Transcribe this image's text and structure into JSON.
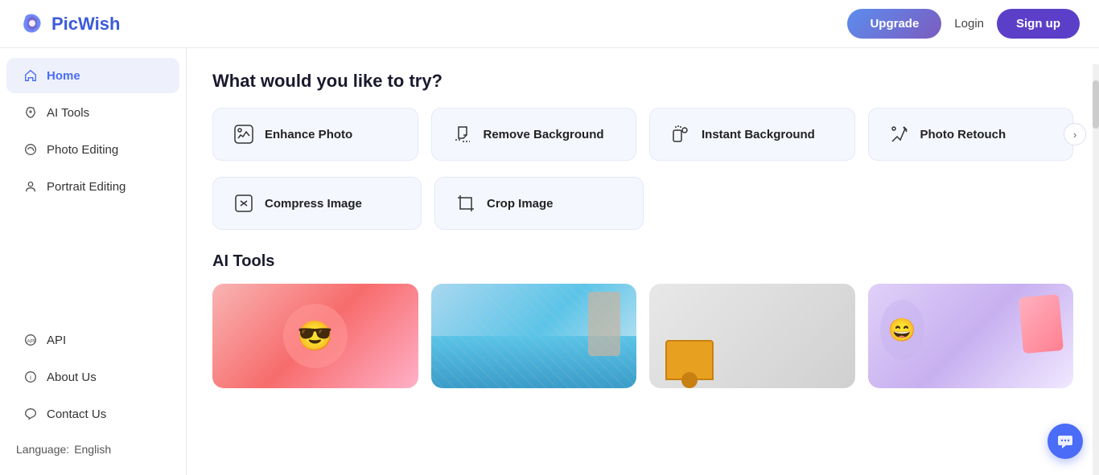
{
  "header": {
    "logo_text": "PicWish",
    "upgrade_label": "Upgrade",
    "login_label": "Login",
    "signup_label": "Sign up"
  },
  "sidebar": {
    "items": [
      {
        "id": "home",
        "label": "Home",
        "icon": "🏠",
        "active": true
      },
      {
        "id": "ai-tools",
        "label": "AI Tools",
        "icon": "✂️",
        "active": false
      },
      {
        "id": "photo-editing",
        "label": "Photo Editing",
        "icon": "🎨",
        "active": false
      },
      {
        "id": "portrait-editing",
        "label": "Portrait Editing",
        "icon": "👤",
        "active": false
      },
      {
        "id": "api",
        "label": "API",
        "icon": "⚙️",
        "active": false
      },
      {
        "id": "about-us",
        "label": "About Us",
        "icon": "ℹ️",
        "active": false
      },
      {
        "id": "contact-us",
        "label": "Contact Us",
        "icon": "🎧",
        "active": false
      }
    ],
    "language_label": "Language:",
    "language_value": "English"
  },
  "main": {
    "prompt_title": "What would you like to try?",
    "tool_cards": [
      {
        "id": "enhance-photo",
        "label": "Enhance Photo",
        "icon": "enhance"
      },
      {
        "id": "remove-background",
        "label": "Remove Background",
        "icon": "remove-bg"
      },
      {
        "id": "instant-background",
        "label": "Instant Background",
        "icon": "instant-bg"
      },
      {
        "id": "photo-retouch",
        "label": "Photo Retouch",
        "icon": "retouch"
      }
    ],
    "tool_cards_row2": [
      {
        "id": "compress-image",
        "label": "Compress Image",
        "icon": "compress"
      },
      {
        "id": "crop-image",
        "label": "Crop Image",
        "icon": "crop"
      }
    ],
    "ai_section_title": "AI Tools",
    "ai_images": [
      {
        "id": "ai-img-1",
        "color_class": "ai-img-1"
      },
      {
        "id": "ai-img-2",
        "color_class": "ai-img-2"
      },
      {
        "id": "ai-img-3",
        "color_class": "ai-img-3"
      },
      {
        "id": "ai-img-4",
        "color_class": "ai-img-4"
      }
    ]
  },
  "icons": {
    "chat": "💬",
    "chevron_right": "›"
  }
}
